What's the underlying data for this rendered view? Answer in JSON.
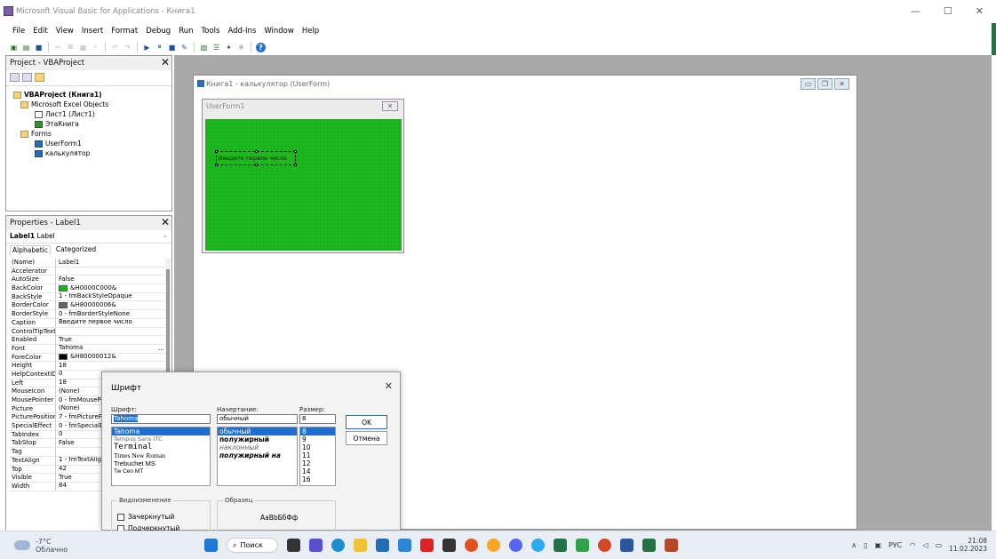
{
  "window": {
    "title": "Microsoft Visual Basic for Applications - Книга1",
    "min": "—",
    "max": "☐",
    "close": "✕"
  },
  "menu": [
    "File",
    "Edit",
    "View",
    "Insert",
    "Format",
    "Debug",
    "Run",
    "Tools",
    "Add-Ins",
    "Window",
    "Help"
  ],
  "project": {
    "title": "Project - VBAProject",
    "close": "✕",
    "tree": [
      {
        "label": "VBAProject (Книга1)",
        "indent": 0,
        "icon": "folder",
        "bold": true
      },
      {
        "label": "Microsoft Excel Objects",
        "indent": 1,
        "icon": "folder"
      },
      {
        "label": "Лист1 (Лист1)",
        "indent": 3,
        "icon": "sheet"
      },
      {
        "label": "ЭтаКнига",
        "indent": 3,
        "icon": "book"
      },
      {
        "label": "Forms",
        "indent": 1,
        "icon": "folder"
      },
      {
        "label": "UserForm1",
        "indent": 3,
        "icon": "form"
      },
      {
        "label": "калькулятор",
        "indent": 3,
        "icon": "form"
      }
    ]
  },
  "properties": {
    "title": "Properties - Label1",
    "close": "✕",
    "object_name": "Label1",
    "object_type": "Label",
    "tab_alpha": "Alphabetic",
    "tab_cat": "Categorized",
    "rows": [
      {
        "k": "(Name)",
        "v": "Label1"
      },
      {
        "k": "Accelerator",
        "v": ""
      },
      {
        "k": "AutoSize",
        "v": "False"
      },
      {
        "k": "BackColor",
        "v": "&H0000C000&",
        "color": "#00c000"
      },
      {
        "k": "BackStyle",
        "v": "1 - fmBackStyleOpaque"
      },
      {
        "k": "BorderColor",
        "v": "&H80000006&",
        "color": "#646464"
      },
      {
        "k": "BorderStyle",
        "v": "0 - fmBorderStyleNone"
      },
      {
        "k": "Caption",
        "v": "Введите первое число"
      },
      {
        "k": "ControlTipText",
        "v": ""
      },
      {
        "k": "Enabled",
        "v": "True"
      },
      {
        "k": "Font",
        "v": "Tahoma",
        "dots": "..."
      },
      {
        "k": "ForeColor",
        "v": "&H80000012&",
        "color": "#000000"
      },
      {
        "k": "Height",
        "v": "18"
      },
      {
        "k": "HelpContextID",
        "v": "0"
      },
      {
        "k": "Left",
        "v": "18"
      },
      {
        "k": "MouseIcon",
        "v": "(None)"
      },
      {
        "k": "MousePointer",
        "v": "0 - fmMousePo"
      },
      {
        "k": "Picture",
        "v": "(None)"
      },
      {
        "k": "PicturePosition",
        "v": "7 - fmPicturePo"
      },
      {
        "k": "SpecialEffect",
        "v": "0 - fmSpecialEf"
      },
      {
        "k": "TabIndex",
        "v": "0"
      },
      {
        "k": "TabStop",
        "v": "False"
      },
      {
        "k": "Tag",
        "v": ""
      },
      {
        "k": "TextAlign",
        "v": "1 - fmTextAlign"
      },
      {
        "k": "Top",
        "v": "42"
      },
      {
        "k": "Visible",
        "v": "True"
      },
      {
        "k": "Width",
        "v": "84"
      }
    ]
  },
  "designer": {
    "title": "Книга1 - калькулятор (UserForm)",
    "form_title": "UserForm1",
    "form_close": "✕",
    "label_caption": "Введите первое число",
    "form_color": "#1db81d"
  },
  "font_dialog": {
    "title": "Шрифт",
    "close": "✕",
    "font_label": "Шрифт:",
    "font_value": "Tahoma",
    "fonts": [
      "Tahoma",
      "Tempus Sans ITC",
      "Terminal",
      "Times New Roman",
      "Trebuchet MS",
      "Tw Cen MT"
    ],
    "style_label": "Начертание:",
    "style_value": "обычный",
    "styles": [
      "обычный",
      "полужирный",
      "наклонный",
      "полужирный на"
    ],
    "size_label": "Размер:",
    "size_value": "8",
    "sizes": [
      "8",
      "9",
      "10",
      "11",
      "12",
      "14",
      "16"
    ],
    "ok": "OK",
    "cancel": "Отмена",
    "effects_label": "Видоизменение",
    "strike": "Зачеркнутый",
    "underline": "Подчеркнутый",
    "sample_label": "Образец",
    "sample_text": "AaBbБбФф"
  },
  "taskbar": {
    "temp": "-7°C",
    "weather": "Облачно",
    "search": "Поиск",
    "lang": "РУС",
    "time": "21:08",
    "date": "11.02.2023"
  }
}
